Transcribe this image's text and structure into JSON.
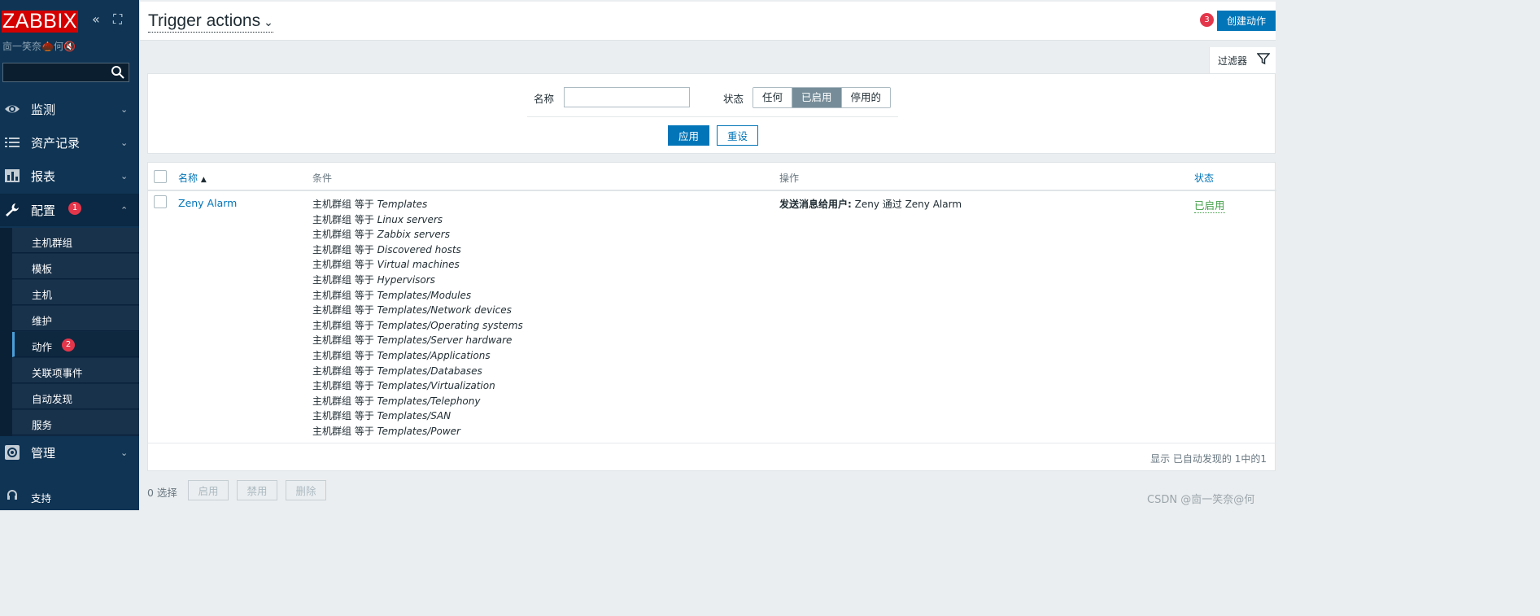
{
  "sidebar": {
    "logo": "ZABBIX",
    "collapse_icon": "«",
    "kiosk_icon": "⛶",
    "user_line": "㐭一笑奈🌰何🔇",
    "search_placeholder": "",
    "menu": [
      {
        "label": "监测",
        "icon": "eye-icon"
      },
      {
        "label": "资产记录",
        "icon": "list-icon"
      },
      {
        "label": "报表",
        "icon": "chart-icon"
      },
      {
        "label": "配置",
        "icon": "wrench-icon",
        "badge": "1",
        "expanded": true
      },
      {
        "label": "管理",
        "icon": "gear-icon"
      }
    ],
    "submenu": [
      {
        "label": "主机群组"
      },
      {
        "label": "模板"
      },
      {
        "label": "主机"
      },
      {
        "label": "维护"
      },
      {
        "label": "动作",
        "badge": "2",
        "active": true
      },
      {
        "label": "关联项事件"
      },
      {
        "label": "自动发现"
      },
      {
        "label": "服务"
      }
    ],
    "support_label": "支持"
  },
  "header": {
    "title": "Trigger actions",
    "badge": "3",
    "create_button": "创建动作"
  },
  "filter": {
    "tab_label": "过滤器",
    "name_label": "名称",
    "name_value": "",
    "status_label": "状态",
    "status_options": [
      "任何",
      "已启用",
      "停用的"
    ],
    "status_selected": "已启用",
    "apply_button": "应用",
    "reset_button": "重设"
  },
  "table": {
    "columns": {
      "name": "名称",
      "conditions": "条件",
      "operations": "操作",
      "status": "状态"
    },
    "sort_indicator": "▲",
    "rows": [
      {
        "name": "Zeny Alarm",
        "conditions": [
          {
            "prefix": "主机群组 等于",
            "value": "Templates"
          },
          {
            "prefix": "主机群组 等于",
            "value": "Linux servers"
          },
          {
            "prefix": "主机群组 等于",
            "value": "Zabbix servers"
          },
          {
            "prefix": "主机群组 等于",
            "value": "Discovered hosts"
          },
          {
            "prefix": "主机群组 等于",
            "value": "Virtual machines"
          },
          {
            "prefix": "主机群组 等于",
            "value": "Hypervisors"
          },
          {
            "prefix": "主机群组 等于",
            "value": "Templates/Modules"
          },
          {
            "prefix": "主机群组 等于",
            "value": "Templates/Network devices"
          },
          {
            "prefix": "主机群组 等于",
            "value": "Templates/Operating systems"
          },
          {
            "prefix": "主机群组 等于",
            "value": "Templates/Server hardware"
          },
          {
            "prefix": "主机群组 等于",
            "value": "Templates/Applications"
          },
          {
            "prefix": "主机群组 等于",
            "value": "Templates/Databases"
          },
          {
            "prefix": "主机群组 等于",
            "value": "Templates/Virtualization"
          },
          {
            "prefix": "主机群组 等于",
            "value": "Templates/Telephony"
          },
          {
            "prefix": "主机群组 等于",
            "value": "Templates/SAN"
          },
          {
            "prefix": "主机群组 等于",
            "value": "Templates/Power"
          }
        ],
        "operation_label": "发送消息给用户:",
        "operation_value": "Zeny 通过 Zeny Alarm",
        "status": "已启用"
      }
    ],
    "footer": "显示 已自动发现的 1中的1"
  },
  "bottom": {
    "selected": "0 选择",
    "enable_button": "启用",
    "disable_button": "禁用",
    "delete_button": "删除"
  },
  "watermark": "CSDN @㐭一笑奈@何",
  "colors": {
    "sidebar_bg": "#0f3454",
    "logo_bg": "#d40000",
    "accent_blue": "#0275b8",
    "badge_red": "#e4364a",
    "status_green": "#429e47",
    "segment_selected": "#768d99"
  }
}
